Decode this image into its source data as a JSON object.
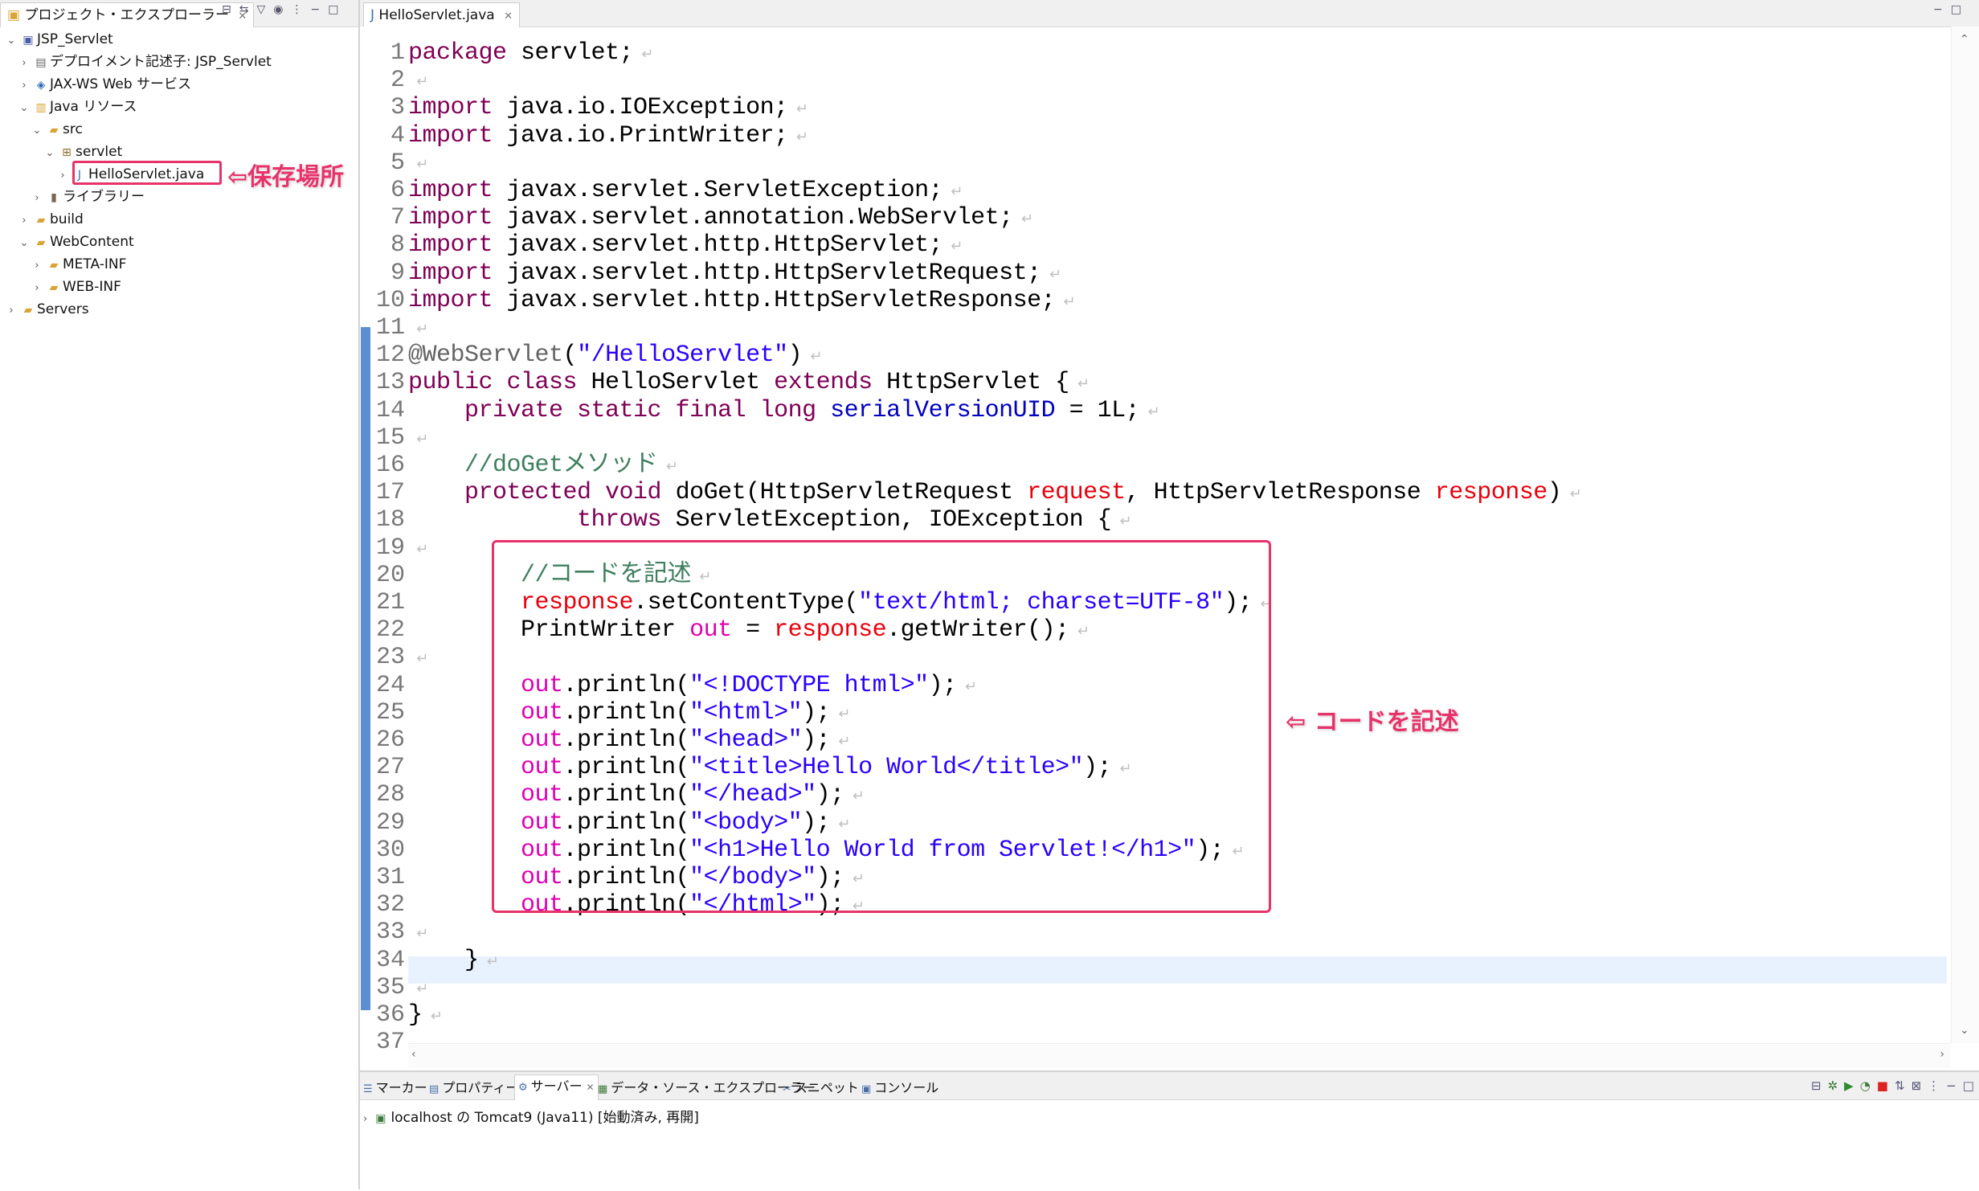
{
  "explorer": {
    "tab_label": "プロジェクト・エクスプローラー",
    "tab_close": "✕",
    "items": [
      {
        "label": "JSP_Servlet",
        "icon": "project-icon",
        "arrow": "⌄"
      },
      {
        "label": "デプロイメント記述子: JSP_Servlet",
        "icon": "descriptor-icon",
        "arrow": "›"
      },
      {
        "label": "JAX-WS Web サービス",
        "icon": "webservice-icon",
        "arrow": "›"
      },
      {
        "label": "Java リソース",
        "icon": "java-resources-icon",
        "arrow": "⌄"
      },
      {
        "label": "src",
        "icon": "folder-icon",
        "arrow": "⌄"
      },
      {
        "label": "servlet",
        "icon": "package-icon",
        "arrow": "⌄"
      },
      {
        "label": "HelloServlet.java",
        "icon": "java-file-icon",
        "arrow": "›"
      },
      {
        "label": "ライブラリー",
        "icon": "library-icon",
        "arrow": "›"
      },
      {
        "label": "build",
        "icon": "folder-icon",
        "arrow": "›"
      },
      {
        "label": "WebContent",
        "icon": "folder-icon",
        "arrow": "⌄"
      },
      {
        "label": "META-INF",
        "icon": "folder-icon",
        "arrow": "›"
      },
      {
        "label": "WEB-INF",
        "icon": "folder-icon",
        "arrow": "›"
      },
      {
        "label": "Servers",
        "icon": "folder-icon",
        "arrow": "›"
      }
    ],
    "callout": "⇦保存場所"
  },
  "editor": {
    "tab_label": "HelloServlet.java",
    "tab_close": "✕",
    "callout": "⇦ コードを記述",
    "line_numbers": [
      "1",
      "2",
      "3",
      "4",
      "5",
      "6",
      "7",
      "8",
      "9",
      "10",
      "11",
      "12",
      "13",
      "14",
      "15",
      "16",
      "17",
      "18",
      "19",
      "20",
      "21",
      "22",
      "23",
      "24",
      "25",
      "26",
      "27",
      "28",
      "29",
      "30",
      "31",
      "32",
      "33",
      "34",
      "35",
      "36",
      "37"
    ],
    "lines": [
      [
        {
          "t": "package",
          "c": "kw"
        },
        {
          "t": " servlet;"
        }
      ],
      [],
      [
        {
          "t": "import",
          "c": "kw"
        },
        {
          "t": " java.io.IOException;"
        }
      ],
      [
        {
          "t": "import",
          "c": "kw"
        },
        {
          "t": " java.io.PrintWriter;"
        }
      ],
      [],
      [
        {
          "t": "import",
          "c": "kw"
        },
        {
          "t": " javax.servlet.ServletException;"
        }
      ],
      [
        {
          "t": "import",
          "c": "kw"
        },
        {
          "t": " javax.servlet.annotation.WebServlet;"
        }
      ],
      [
        {
          "t": "import",
          "c": "kw"
        },
        {
          "t": " javax.servlet.http.HttpServlet;"
        }
      ],
      [
        {
          "t": "import",
          "c": "kw"
        },
        {
          "t": " javax.servlet.http.HttpServletRequest;"
        }
      ],
      [
        {
          "t": "import",
          "c": "kw"
        },
        {
          "t": " javax.servlet.http.HttpServletResponse;"
        }
      ],
      [],
      [
        {
          "t": "@WebServlet",
          "c": "ann"
        },
        {
          "t": "("
        },
        {
          "t": "\"/HelloServlet\"",
          "c": "str"
        },
        {
          "t": ")"
        }
      ],
      [
        {
          "t": "public class",
          "c": "kw"
        },
        {
          "t": " HelloServlet "
        },
        {
          "t": "extends",
          "c": "kw"
        },
        {
          "t": " HttpServlet {"
        }
      ],
      [
        {
          "t": "    "
        },
        {
          "t": "private static final long",
          "c": "kw"
        },
        {
          "t": " "
        },
        {
          "t": "serialVersionUID",
          "c": "fld"
        },
        {
          "t": " = 1L;"
        }
      ],
      [],
      [
        {
          "t": "    "
        },
        {
          "t": "//doGetメソッド",
          "c": "cm"
        }
      ],
      [
        {
          "t": "    "
        },
        {
          "t": "protected void",
          "c": "kw"
        },
        {
          "t": " doGet(HttpServletRequest "
        },
        {
          "t": "request",
          "c": "var"
        },
        {
          "t": ", HttpServletResponse "
        },
        {
          "t": "response",
          "c": "var"
        },
        {
          "t": ")"
        }
      ],
      [
        {
          "t": "            "
        },
        {
          "t": "throws",
          "c": "kw"
        },
        {
          "t": " ServletException, IOException {"
        }
      ],
      [],
      [
        {
          "t": "        "
        },
        {
          "t": "//コードを記述",
          "c": "cm"
        }
      ],
      [
        {
          "t": "        "
        },
        {
          "t": "response",
          "c": "var"
        },
        {
          "t": ".setContentType("
        },
        {
          "t": "\"text/html; charset=UTF-8\"",
          "c": "str"
        },
        {
          "t": ");"
        }
      ],
      [
        {
          "t": "        PrintWriter "
        },
        {
          "t": "out",
          "c": "lv"
        },
        {
          "t": " = "
        },
        {
          "t": "response",
          "c": "var"
        },
        {
          "t": ".getWriter();"
        }
      ],
      [],
      [
        {
          "t": "        "
        },
        {
          "t": "out",
          "c": "lv"
        },
        {
          "t": ".println("
        },
        {
          "t": "\"<!DOCTYPE html>\"",
          "c": "str"
        },
        {
          "t": ");"
        }
      ],
      [
        {
          "t": "        "
        },
        {
          "t": "out",
          "c": "lv"
        },
        {
          "t": ".println("
        },
        {
          "t": "\"<html>\"",
          "c": "str"
        },
        {
          "t": ");"
        }
      ],
      [
        {
          "t": "        "
        },
        {
          "t": "out",
          "c": "lv"
        },
        {
          "t": ".println("
        },
        {
          "t": "\"<head>\"",
          "c": "str"
        },
        {
          "t": ");"
        }
      ],
      [
        {
          "t": "        "
        },
        {
          "t": "out",
          "c": "lv"
        },
        {
          "t": ".println("
        },
        {
          "t": "\"<title>Hello World</title>\"",
          "c": "str"
        },
        {
          "t": ");"
        }
      ],
      [
        {
          "t": "        "
        },
        {
          "t": "out",
          "c": "lv"
        },
        {
          "t": ".println("
        },
        {
          "t": "\"</head>\"",
          "c": "str"
        },
        {
          "t": ");"
        }
      ],
      [
        {
          "t": "        "
        },
        {
          "t": "out",
          "c": "lv"
        },
        {
          "t": ".println("
        },
        {
          "t": "\"<body>\"",
          "c": "str"
        },
        {
          "t": ");"
        }
      ],
      [
        {
          "t": "        "
        },
        {
          "t": "out",
          "c": "lv"
        },
        {
          "t": ".println("
        },
        {
          "t": "\"<h1>Hello World from Servlet!</h1>\"",
          "c": "str"
        },
        {
          "t": ");"
        }
      ],
      [
        {
          "t": "        "
        },
        {
          "t": "out",
          "c": "lv"
        },
        {
          "t": ".println("
        },
        {
          "t": "\"</body>\"",
          "c": "str"
        },
        {
          "t": ");"
        }
      ],
      [
        {
          "t": "        "
        },
        {
          "t": "out",
          "c": "lv"
        },
        {
          "t": ".println("
        },
        {
          "t": "\"</html>\"",
          "c": "str"
        },
        {
          "t": ");"
        }
      ],
      [],
      [
        {
          "t": "    }"
        }
      ],
      [],
      [
        {
          "t": "}"
        }
      ],
      []
    ]
  },
  "bottom_panel": {
    "tabs": [
      "マーカー",
      "プロパティー",
      "サーバー",
      "データ・ソース・エクスプローラー",
      "スニペット",
      "コンソール"
    ],
    "server_entry": "localhost の Tomcat9 (Java11)  [始動済み, 再開]"
  },
  "colors": {
    "highlight": "#e7326a",
    "keyword": "#7f0055",
    "string": "#2a00ff",
    "comment": "#3f7f5f",
    "current_line": "#e8f2fe"
  }
}
